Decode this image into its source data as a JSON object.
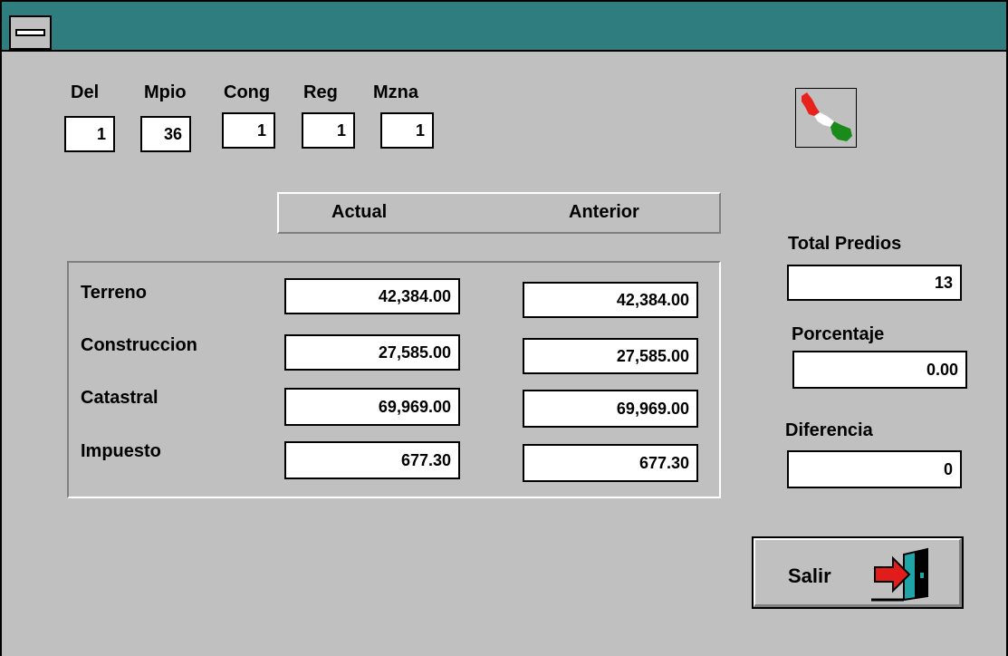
{
  "window": {
    "title": ""
  },
  "location": {
    "del_label": "Del",
    "del_value": "1",
    "mpio_label": "Mpio",
    "mpio_value": "36",
    "cong_label": "Cong",
    "cong_value": "1",
    "reg_label": "Reg",
    "reg_value": "1",
    "mzna_label": "Mzna",
    "mzna_value": "1"
  },
  "columns": {
    "actual": "Actual",
    "anterior": "Anterior"
  },
  "rows": [
    {
      "label": "Terreno",
      "actual": "42,384.00",
      "anterior": "42,384.00"
    },
    {
      "label": "Construccion",
      "actual": "27,585.00",
      "anterior": "27,585.00"
    },
    {
      "label": "Catastral",
      "actual": "69,969.00",
      "anterior": "69,969.00"
    },
    {
      "label": "Impuesto",
      "actual": "677.30",
      "anterior": "677.30"
    }
  ],
  "summary": {
    "total_predios_label": "Total Predios",
    "total_predios_value": "13",
    "porcentaje_label": "Porcentaje",
    "porcentaje_value": "0.00",
    "diferencia_label": "Diferencia",
    "diferencia_value": "0"
  },
  "buttons": {
    "salir_label": "Salir"
  },
  "icons": {
    "system_menu": "system-menu-icon",
    "logo": "mexico-map-icon",
    "exit": "exit-door-icon"
  },
  "colors": {
    "titlebar": "#2f7d7e",
    "face": "#c0c0c0",
    "map_red": "#e8231e",
    "map_green": "#1a8a1a",
    "door_teal": "#1fa5a8",
    "arrow_red": "#e21b1b"
  }
}
